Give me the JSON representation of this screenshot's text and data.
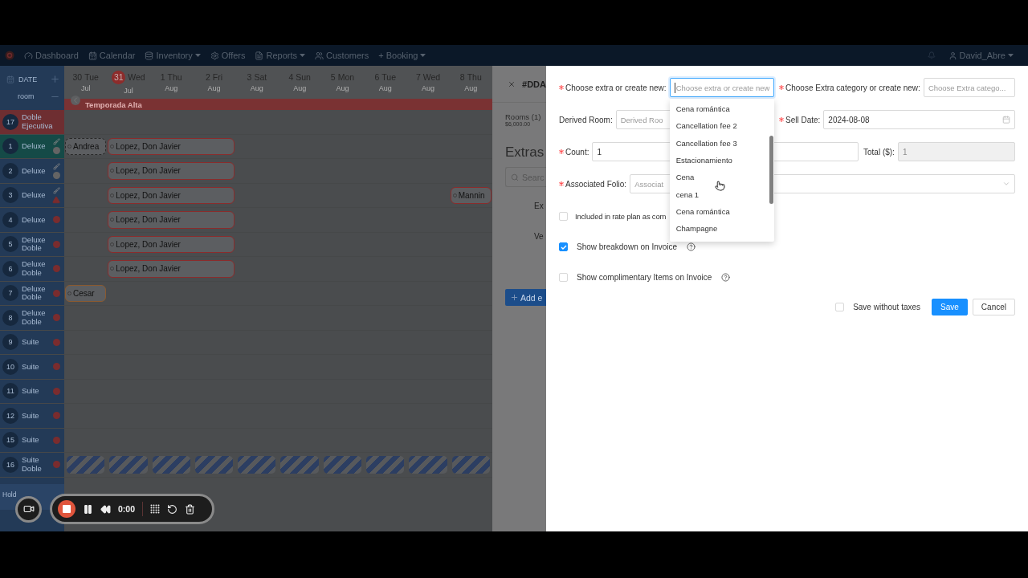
{
  "nav": {
    "items": [
      {
        "label": "Dashboard",
        "caret": false
      },
      {
        "label": "Calendar",
        "caret": false
      },
      {
        "label": "Inventory",
        "caret": true
      },
      {
        "label": "Offers",
        "caret": false
      },
      {
        "label": "Reports",
        "caret": true
      },
      {
        "label": "Customers",
        "caret": false
      },
      {
        "label": "+ Booking",
        "caret": true
      }
    ],
    "user": "David_Abre"
  },
  "calendar": {
    "corner": {
      "title": "DATE",
      "subtitle": "room"
    },
    "days": [
      {
        "date": "30",
        "weekday": "Tue",
        "month": "Jul",
        "today": false
      },
      {
        "date": "31",
        "weekday": "Wed",
        "month": "Jul",
        "today": true
      },
      {
        "date": "1",
        "weekday": "Thu",
        "month": "Aug",
        "today": false
      },
      {
        "date": "2",
        "weekday": "Fri",
        "month": "Aug",
        "today": false
      },
      {
        "date": "3",
        "weekday": "Sat",
        "month": "Aug",
        "today": false
      },
      {
        "date": "4",
        "weekday": "Sun",
        "month": "Aug",
        "today": false
      },
      {
        "date": "5",
        "weekday": "Mon",
        "month": "Aug",
        "today": false
      },
      {
        "date": "6",
        "weekday": "Tue",
        "month": "Aug",
        "today": false
      },
      {
        "date": "7",
        "weekday": "Wed",
        "month": "Aug",
        "today": false
      },
      {
        "date": "8",
        "weekday": "Thu",
        "month": "Aug",
        "today": false
      }
    ],
    "season": "Temporada Alta",
    "rooms": [
      {
        "number": "17",
        "name": "Doble Ejecutiva",
        "color": "#6e2e31"
      },
      {
        "number": "1",
        "name": "Deluxe",
        "color": "#154a47",
        "flags": [
          {
            "kind": "brush"
          },
          {
            "kind": "dot",
            "color": "#646464"
          }
        ],
        "cells": [
          {
            "kind": "booking",
            "guest": "Andrea",
            "color": "#2a2a2a",
            "dashed": true
          },
          {
            "kind": "booking",
            "guest": "Lopez, Don Javier",
            "color": "#8a2c2c",
            "dashed": false
          },
          {
            "kind": "more"
          },
          {
            "kind": "more"
          }
        ]
      },
      {
        "number": "2",
        "name": "Deluxe",
        "color": "#233a57",
        "flags": [
          {
            "kind": "brush"
          },
          {
            "kind": "dot",
            "color": "#646464"
          }
        ],
        "cells": [
          {
            "kind": "empty"
          },
          {
            "kind": "booking",
            "guest": "Lopez, Don Javier",
            "color": "#8a2c2c",
            "dashed": false
          },
          {
            "kind": "more"
          },
          {
            "kind": "more"
          }
        ]
      },
      {
        "number": "3",
        "name": "Deluxe",
        "color": "#233a57",
        "flags": [
          {
            "kind": "brush"
          },
          {
            "kind": "warning"
          }
        ],
        "cells": [
          {
            "kind": "empty"
          },
          {
            "kind": "booking",
            "guest": "Lopez, Don Javier",
            "color": "#8a2c2c",
            "dashed": false
          },
          {
            "kind": "more"
          },
          {
            "kind": "more"
          },
          {
            "kind": "empty"
          },
          {
            "kind": "empty"
          },
          {
            "kind": "empty"
          },
          {
            "kind": "empty"
          },
          {
            "kind": "empty"
          },
          {
            "kind": "booking",
            "guest": "Mannin",
            "color": "#8a2c2c",
            "dashed": false
          }
        ]
      },
      {
        "number": "4",
        "name": "Deluxe",
        "color": "#233a57",
        "flags": [
          {
            "kind": "dot",
            "color": "#7a2c2e"
          }
        ],
        "cells": [
          {
            "kind": "empty"
          },
          {
            "kind": "booking",
            "guest": "Lopez, Don Javier",
            "color": "#8a2c2c",
            "dashed": false
          },
          {
            "kind": "more"
          },
          {
            "kind": "more"
          }
        ]
      },
      {
        "number": "5",
        "name": "Deluxe Doble",
        "color": "#233a57",
        "flags": [
          {
            "kind": "dot",
            "color": "#7a2c2e"
          }
        ],
        "cells": [
          {
            "kind": "empty"
          },
          {
            "kind": "booking",
            "guest": "Lopez, Don Javier",
            "color": "#8a2c2c",
            "dashed": false
          },
          {
            "kind": "more"
          },
          {
            "kind": "more"
          }
        ]
      },
      {
        "number": "6",
        "name": "Deluxe Doble",
        "color": "#233a57",
        "flags": [
          {
            "kind": "dot",
            "color": "#7a2c2e"
          }
        ],
        "cells": [
          {
            "kind": "empty"
          },
          {
            "kind": "booking",
            "guest": "Lopez, Don Javier",
            "color": "#8a2c2c",
            "dashed": false
          },
          {
            "kind": "more"
          },
          {
            "kind": "more"
          }
        ]
      },
      {
        "number": "7",
        "name": "Deluxe Doble",
        "color": "#233a57",
        "flags": [
          {
            "kind": "dot",
            "color": "#7a2c2e"
          }
        ],
        "cells": [
          {
            "kind": "booking",
            "guest": "Cesar",
            "color": "#8a5a30",
            "dashed": false
          }
        ]
      },
      {
        "number": "8",
        "name": "Deluxe Doble",
        "color": "#233a57",
        "flags": [
          {
            "kind": "dot",
            "color": "#7a2c2e"
          }
        ]
      },
      {
        "number": "9",
        "name": "Suite",
        "color": "#233a57",
        "flags": [
          {
            "kind": "dot",
            "color": "#7a2c2e"
          }
        ]
      },
      {
        "number": "10",
        "name": "Suite",
        "color": "#233a57",
        "flags": [
          {
            "kind": "dot",
            "color": "#7a2c2e"
          }
        ]
      },
      {
        "number": "11",
        "name": "Suite",
        "color": "#233a57",
        "flags": [
          {
            "kind": "dot",
            "color": "#7a2c2e"
          }
        ]
      },
      {
        "number": "12",
        "name": "Suite",
        "color": "#233a57",
        "flags": [
          {
            "kind": "dot",
            "color": "#7a2c2e"
          }
        ]
      },
      {
        "number": "15",
        "name": "Suite",
        "color": "#233a57",
        "flags": [
          {
            "kind": "dot",
            "color": "#7a2c2e"
          }
        ]
      },
      {
        "number": "16",
        "name": "Suite Doble",
        "color": "#233a57",
        "flags": [
          {
            "kind": "dot",
            "color": "#7a2c2e"
          }
        ],
        "cells": [
          {
            "kind": "blocked"
          },
          {
            "kind": "blocked"
          },
          {
            "kind": "blocked"
          },
          {
            "kind": "blocked"
          },
          {
            "kind": "blocked"
          },
          {
            "kind": "blocked"
          },
          {
            "kind": "blocked"
          },
          {
            "kind": "blocked"
          },
          {
            "kind": "blocked"
          },
          {
            "kind": "blocked"
          }
        ]
      }
    ],
    "holding": "Hold"
  },
  "drawer": {
    "title": "#DDA",
    "rooms_label": "Rooms (1)",
    "rooms_total": "$6,000.00",
    "heading": "Extras",
    "search_placeholder": "Searc",
    "rows": [
      "Ex",
      "Ve"
    ],
    "add_button": "Add e"
  },
  "form": {
    "extra": {
      "label": "Choose extra or create new:",
      "required": true,
      "placeholder": "Choose extra or create new",
      "focused": true
    },
    "category": {
      "label": "Choose Extra category or create new:",
      "required": true,
      "placeholder": "Choose Extra catego..."
    },
    "derived_room": {
      "label": "Derived Room:",
      "required": false,
      "placeholder": "Derived Roo"
    },
    "sell_date": {
      "label": "Sell Date:",
      "required": true,
      "value": "2024-08-08"
    },
    "count": {
      "label": "Count:",
      "required": true,
      "value": "1"
    },
    "total": {
      "label": "Total ($):",
      "required": false,
      "value": "1",
      "disabled": true
    },
    "folio": {
      "label": "Associated Folio:",
      "required": true,
      "placeholder": "Associat"
    },
    "options": [
      {
        "label": "Included in rate plan as com",
        "checked": false
      },
      {
        "label": "Show breakdown on Invoice",
        "checked": true,
        "help": true
      },
      {
        "label": "Show complimentary Items on Invoice",
        "checked": false,
        "help": true
      }
    ],
    "save_without_taxes": {
      "label": "Save without taxes",
      "checked": false
    },
    "buttons": [
      {
        "label": "Save",
        "primary": true
      },
      {
        "label": "Cancel",
        "primary": false
      }
    ],
    "dropdown": [
      "Cena romántica",
      "Cancellation fee 2",
      "Cancellation fee 3",
      "Estacionamiento",
      "Cena",
      "cena 1",
      "Cena romántica",
      "Champagne"
    ]
  },
  "recorder": {
    "time": "0:00"
  }
}
